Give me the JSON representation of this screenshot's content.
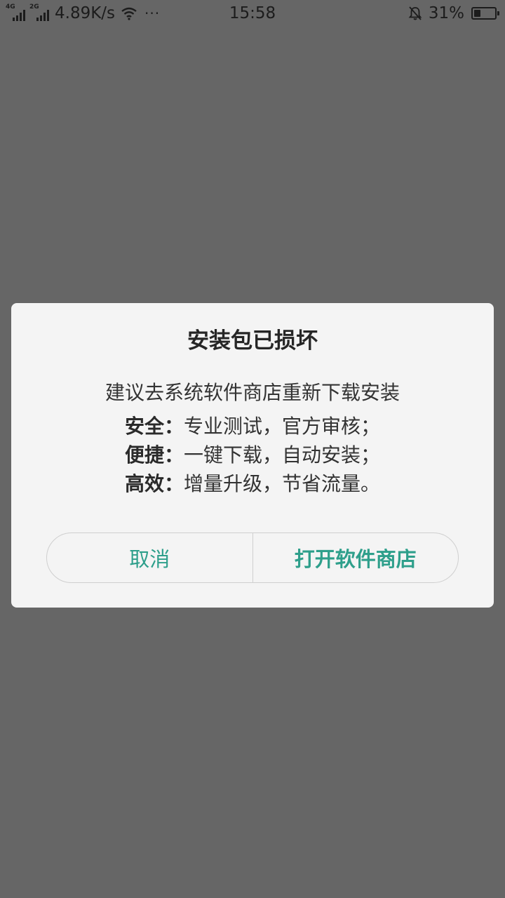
{
  "status_bar": {
    "sim1_label": "4G",
    "sim2_label": "2G",
    "net_speed": "4.89K/s",
    "more": "···",
    "time": "15:58",
    "battery_pct_label": "31%",
    "battery_level": 0.31,
    "icons": [
      "signal-icon",
      "wifi-icon",
      "mute-icon",
      "battery-icon"
    ]
  },
  "dialog": {
    "title": "安装包已损坏",
    "message": "建议去系统软件商店重新下载安装",
    "features": [
      {
        "key": "安全：",
        "value": "专业测试，官方审核；"
      },
      {
        "key": "便捷：",
        "value": "一键下载，自动安装；"
      },
      {
        "key": "高效：",
        "value": "增量升级，节省流量。"
      }
    ],
    "cancel_label": "取消",
    "confirm_label": "打开软件商店"
  },
  "colors": {
    "overlay": "#666666",
    "dialog_bg": "#f4f4f4",
    "accent": "#2e9f8b"
  }
}
